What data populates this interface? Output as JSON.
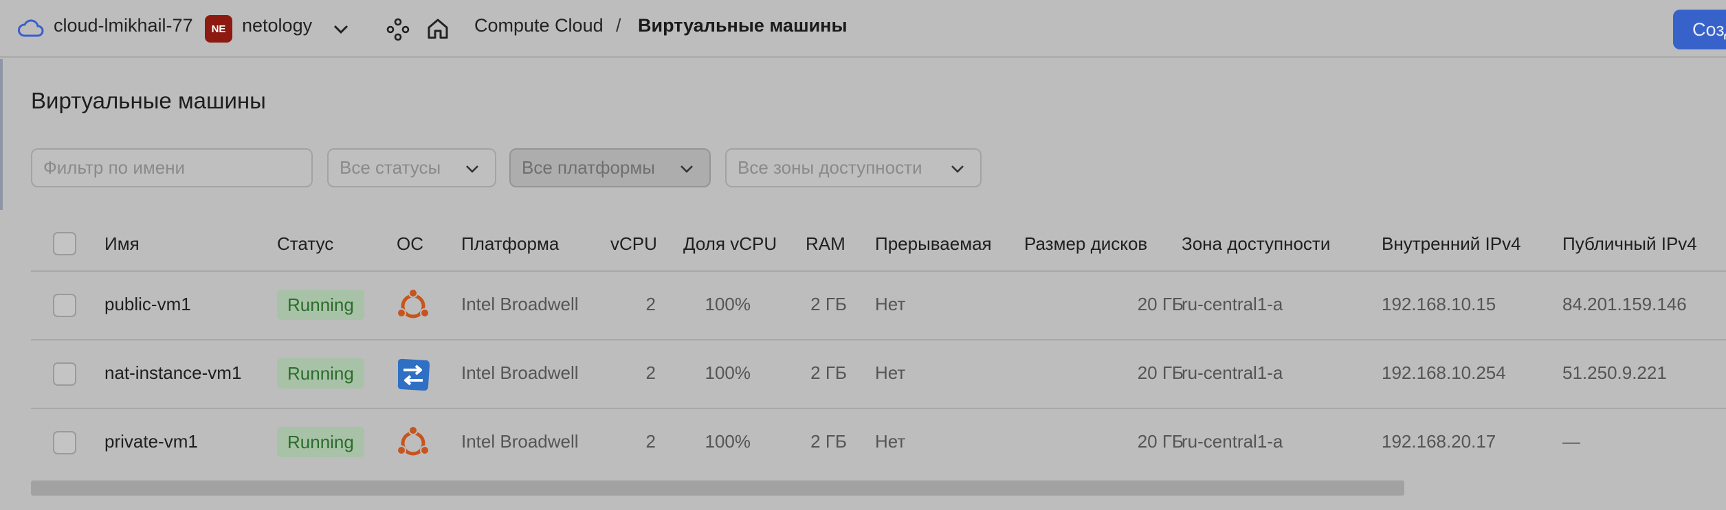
{
  "header": {
    "cloud_icon": "cloud-icon",
    "cloud_name": "cloud-lmikhail-77",
    "org_badge": "NE",
    "org_name": "netology",
    "services_icon": "services-grid-icon",
    "home_icon": "home-icon",
    "breadcrumb": [
      "Compute Cloud",
      "/",
      "Виртуальные машины"
    ],
    "create_button": "Созд"
  },
  "page": {
    "title": "Виртуальные машины"
  },
  "filters": {
    "name_placeholder": "Фильтр по имени",
    "status": "Все статусы",
    "platform": "Все платформы",
    "zone": "Все зоны доступности"
  },
  "table": {
    "columns": [
      "Имя",
      "Статус",
      "ОС",
      "Платформа",
      "vCPU",
      "Доля vCPU",
      "RAM",
      "Прерываемая",
      "Размер дисков",
      "Зона доступности",
      "Внутренний IPv4",
      "Публичный IPv4"
    ],
    "rows": [
      {
        "name": "public-vm1",
        "status": "Running",
        "os_icon": "ubuntu-icon",
        "platform": "Intel Broadwell",
        "vcpu": "2",
        "vcpu_share": "100%",
        "ram": "2 ГБ",
        "preemptible": "Нет",
        "disk_size": "20 ГБ",
        "zone": "ru-central1-a",
        "internal_ip": "192.168.10.15",
        "public_ip": "84.201.159.146"
      },
      {
        "name": "nat-instance-vm1",
        "status": "Running",
        "os_icon": "nat-instance-icon",
        "platform": "Intel Broadwell",
        "vcpu": "2",
        "vcpu_share": "100%",
        "ram": "2 ГБ",
        "preemptible": "Нет",
        "disk_size": "20 ГБ",
        "zone": "ru-central1-a",
        "internal_ip": "192.168.10.254",
        "public_ip": "51.250.9.221"
      },
      {
        "name": "private-vm1",
        "status": "Running",
        "os_icon": "ubuntu-icon",
        "platform": "Intel Broadwell",
        "vcpu": "2",
        "vcpu_share": "100%",
        "ram": "2 ГБ",
        "preemptible": "Нет",
        "disk_size": "20 ГБ",
        "zone": "ru-central1-a",
        "internal_ip": "192.168.20.17",
        "public_ip": "—"
      }
    ]
  },
  "colors": {
    "accent": "#3762c9",
    "status_running_bg": "#a8c2a8",
    "status_running_text": "#2b6d2b",
    "ubuntu": "#c7541e",
    "nat": "#2f6fc4"
  }
}
